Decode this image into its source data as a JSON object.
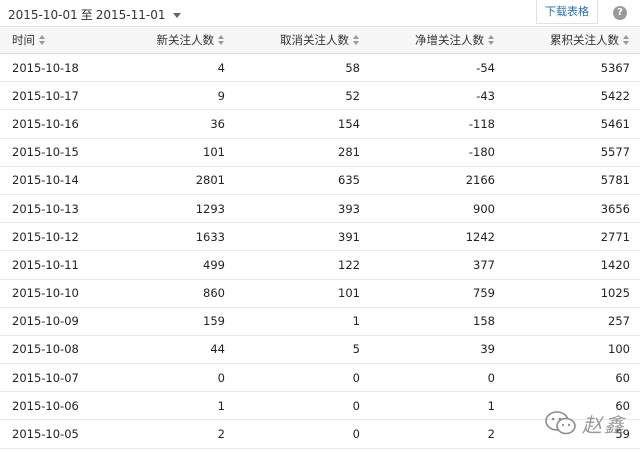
{
  "toolbar": {
    "date_start": "2015-10-01",
    "date_sep": "至",
    "date_end": "2015-11-01",
    "download_label": "下载表格",
    "help_label": "?"
  },
  "table": {
    "columns": [
      "时间",
      "新关注人数",
      "取消关注人数",
      "净增关注人数",
      "累积关注人数"
    ],
    "rows": [
      [
        "2015-10-18",
        "4",
        "58",
        "-54",
        "5367"
      ],
      [
        "2015-10-17",
        "9",
        "52",
        "-43",
        "5422"
      ],
      [
        "2015-10-16",
        "36",
        "154",
        "-118",
        "5461"
      ],
      [
        "2015-10-15",
        "101",
        "281",
        "-180",
        "5577"
      ],
      [
        "2015-10-14",
        "2801",
        "635",
        "2166",
        "5781"
      ],
      [
        "2015-10-13",
        "1293",
        "393",
        "900",
        "3656"
      ],
      [
        "2015-10-12",
        "1633",
        "391",
        "1242",
        "2771"
      ],
      [
        "2015-10-11",
        "499",
        "122",
        "377",
        "1420"
      ],
      [
        "2015-10-10",
        "860",
        "101",
        "759",
        "1025"
      ],
      [
        "2015-10-09",
        "159",
        "1",
        "158",
        "257"
      ],
      [
        "2015-10-08",
        "44",
        "5",
        "39",
        "100"
      ],
      [
        "2015-10-07",
        "0",
        "0",
        "0",
        "60"
      ],
      [
        "2015-10-06",
        "1",
        "0",
        "1",
        "60"
      ],
      [
        "2015-10-05",
        "2",
        "0",
        "2",
        "59"
      ]
    ]
  },
  "watermark": {
    "text": "赵鑫",
    "icon": "wechat-icon"
  }
}
